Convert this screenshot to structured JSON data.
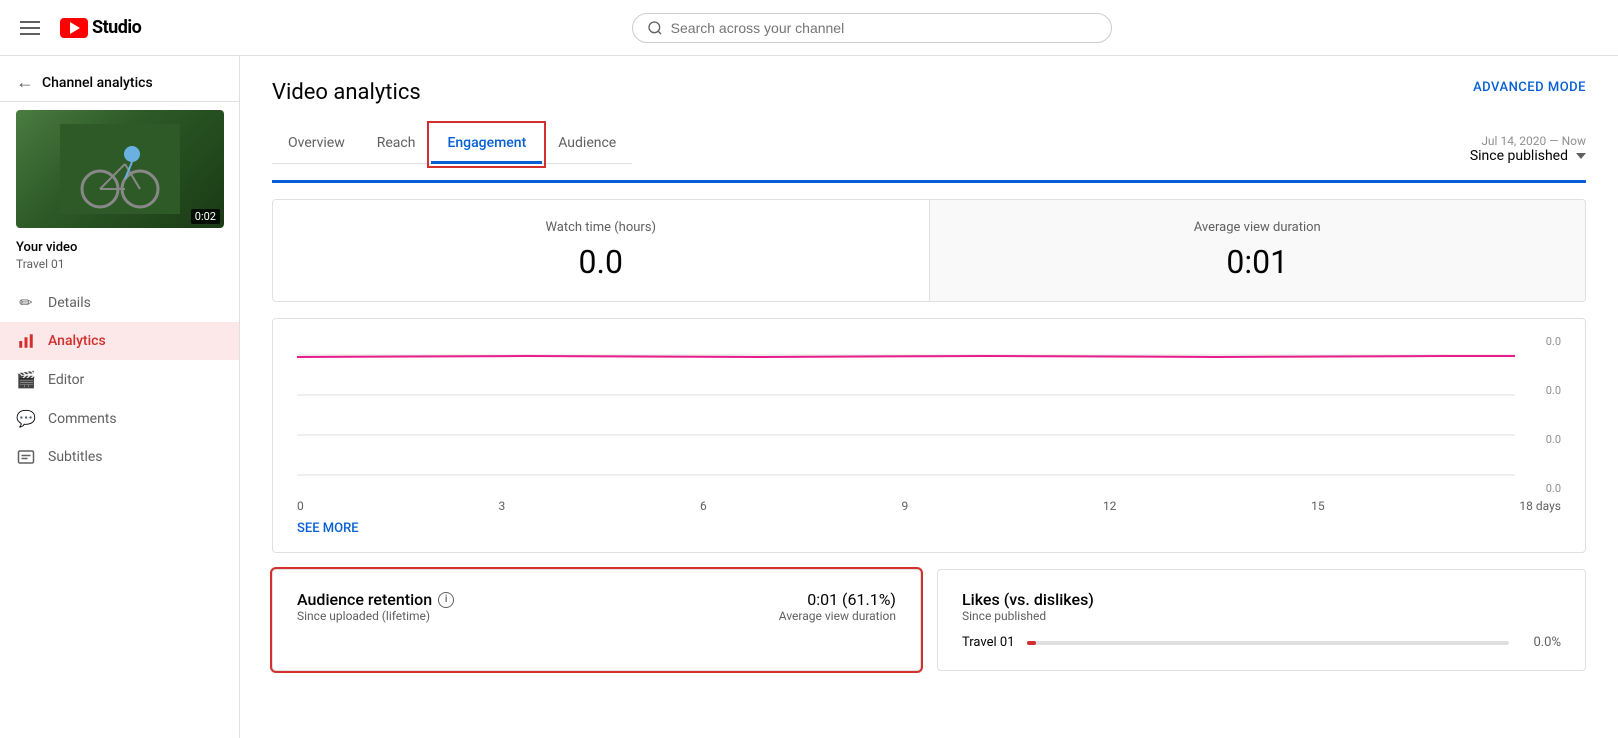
{
  "header": {
    "menu_icon": "hamburger-icon",
    "logo_text": "Studio",
    "search_placeholder": "Search across your channel"
  },
  "sidebar": {
    "back_label": "Channel analytics",
    "video_label": "Your video",
    "video_name": "Travel 01",
    "thumbnail_duration": "0:02",
    "nav_items": [
      {
        "id": "details",
        "label": "Details",
        "icon": "pencil"
      },
      {
        "id": "analytics",
        "label": "Analytics",
        "icon": "bar-chart",
        "active": true
      },
      {
        "id": "editor",
        "label": "Editor",
        "icon": "film"
      },
      {
        "id": "comments",
        "label": "Comments",
        "icon": "comment"
      },
      {
        "id": "subtitles",
        "label": "Subtitles",
        "icon": "subtitles"
      }
    ]
  },
  "main": {
    "page_title": "Video analytics",
    "advanced_mode_label": "ADVANCED MODE",
    "tabs": [
      {
        "id": "overview",
        "label": "Overview",
        "active": false
      },
      {
        "id": "reach",
        "label": "Reach",
        "active": false
      },
      {
        "id": "engagement",
        "label": "Engagement",
        "active": true,
        "highlighted": true
      },
      {
        "id": "audience",
        "label": "Audience",
        "active": false
      }
    ],
    "date_range": {
      "label": "Jul 14, 2020 — Now",
      "value": "Since published"
    },
    "stats": {
      "watch_time_label": "Watch time (hours)",
      "watch_time_value": "0.0",
      "avg_view_label": "Average view duration",
      "avg_view_value": "0:01"
    },
    "chart": {
      "x_labels": [
        "0",
        "3",
        "6",
        "9",
        "12",
        "15",
        "18 days"
      ],
      "y_labels": [
        "0.0",
        "0.0",
        "0.0",
        "0.0"
      ],
      "see_more_label": "SEE MORE"
    },
    "audience_retention": {
      "title": "Audience retention",
      "subtitle": "Since uploaded (lifetime)",
      "value": "0:01 (61.1%)",
      "value_label": "Average view duration",
      "highlighted": true
    },
    "likes": {
      "title": "Likes (vs. dislikes)",
      "subtitle": "Since published",
      "row_label": "Travel 01",
      "row_value": "0.0%"
    }
  }
}
